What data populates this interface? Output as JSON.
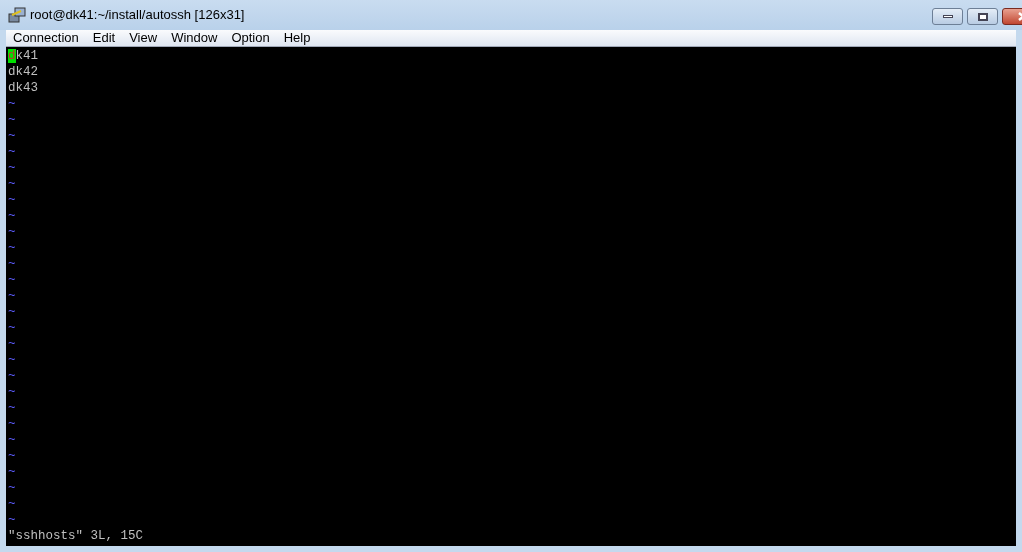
{
  "window": {
    "title": "root@dk41:~/install/autossh [126x31]"
  },
  "menu": [
    "Connection",
    "Edit",
    "View",
    "Window",
    "Option",
    "Help"
  ],
  "terminal": {
    "lines": [
      {
        "kind": "text",
        "text": "dk41",
        "cursor": true
      },
      {
        "kind": "text",
        "text": "dk42",
        "cursor": false
      },
      {
        "kind": "text",
        "text": "dk43",
        "cursor": false
      },
      {
        "kind": "filler",
        "text": "~"
      },
      {
        "kind": "filler",
        "text": "~"
      },
      {
        "kind": "filler",
        "text": "~"
      },
      {
        "kind": "filler",
        "text": "~"
      },
      {
        "kind": "filler",
        "text": "~"
      },
      {
        "kind": "filler",
        "text": "~"
      },
      {
        "kind": "filler",
        "text": "~"
      },
      {
        "kind": "filler",
        "text": "~"
      },
      {
        "kind": "filler",
        "text": "~"
      },
      {
        "kind": "filler",
        "text": "~"
      },
      {
        "kind": "filler",
        "text": "~"
      },
      {
        "kind": "filler",
        "text": "~"
      },
      {
        "kind": "filler",
        "text": "~"
      },
      {
        "kind": "filler",
        "text": "~"
      },
      {
        "kind": "filler",
        "text": "~"
      },
      {
        "kind": "filler",
        "text": "~"
      },
      {
        "kind": "filler",
        "text": "~"
      },
      {
        "kind": "filler",
        "text": "~"
      },
      {
        "kind": "filler",
        "text": "~"
      },
      {
        "kind": "filler",
        "text": "~"
      },
      {
        "kind": "filler",
        "text": "~"
      },
      {
        "kind": "filler",
        "text": "~"
      },
      {
        "kind": "filler",
        "text": "~"
      },
      {
        "kind": "filler",
        "text": "~"
      },
      {
        "kind": "filler",
        "text": "~"
      },
      {
        "kind": "filler",
        "text": "~"
      },
      {
        "kind": "filler",
        "text": "~"
      }
    ],
    "status": "\"sshhosts\" 3L, 15C"
  }
}
